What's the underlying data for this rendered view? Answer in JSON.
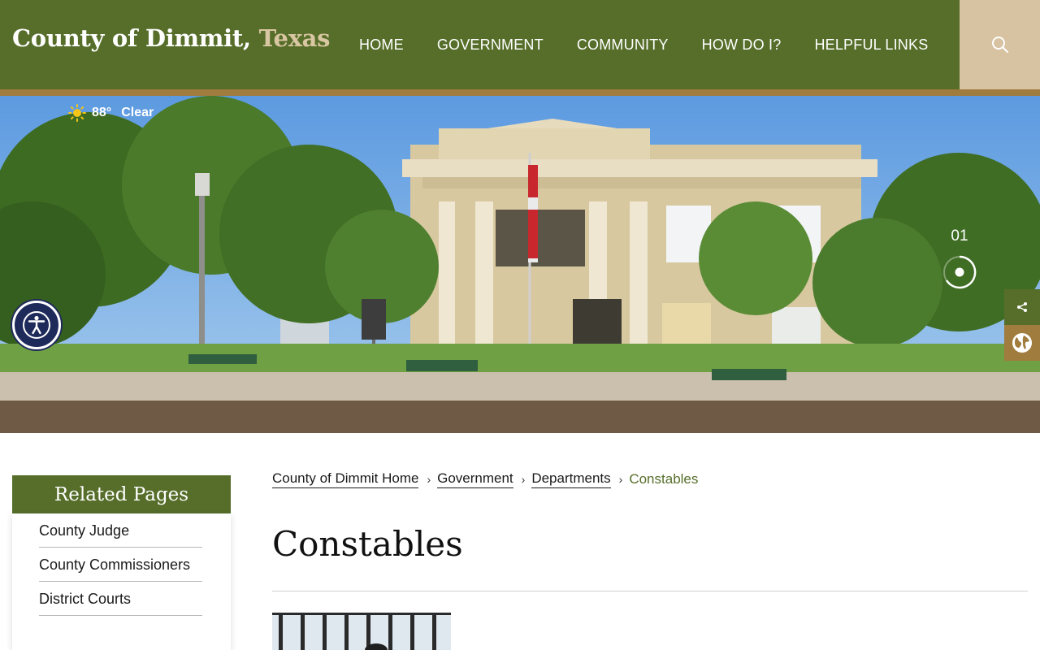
{
  "header": {
    "site_title": "County of Dimmit,",
    "site_title_accent": "Texas",
    "nav": [
      "HOME",
      "GOVERNMENT",
      "COMMUNITY",
      "HOW DO I?",
      "HELPFUL LINKS"
    ]
  },
  "hero": {
    "weather_temp": "88°",
    "weather_condition": "Clear",
    "slide_number": "01"
  },
  "sidebar": {
    "heading": "Related Pages",
    "items": [
      "County Judge",
      "County Commissioners",
      "District Courts"
    ]
  },
  "breadcrumb": {
    "links": [
      "County of Dimmit Home",
      "Government",
      "Departments"
    ],
    "current": "Constables"
  },
  "main": {
    "title": "Constables"
  },
  "colors": {
    "header_green": "#566e2a",
    "accent_brown": "#a07c3e",
    "search_tan": "#d7c2a1",
    "title_accent": "#d9c6a2"
  },
  "icons": [
    "search-icon",
    "sun-icon",
    "accessibility-icon",
    "share-icon",
    "globe-icon",
    "chevron-right-icon"
  ]
}
